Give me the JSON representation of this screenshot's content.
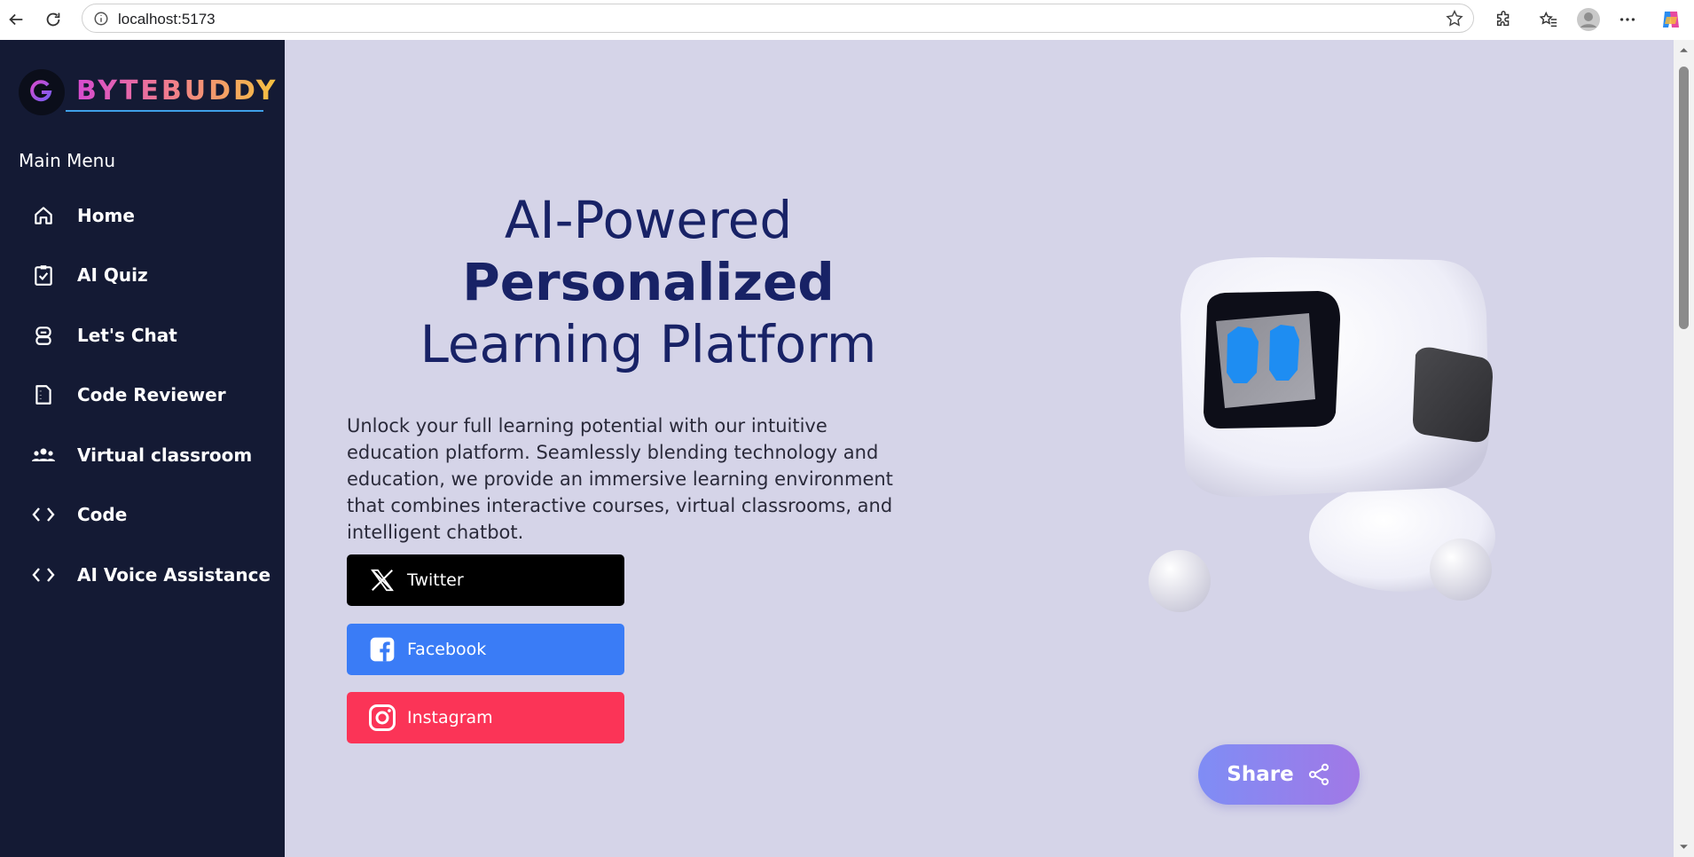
{
  "browser": {
    "url": "localhost:5173"
  },
  "sidebar": {
    "brand": "BYTEBUDDY",
    "menu_title": "Main Menu",
    "items": [
      {
        "label": "Home",
        "icon": "home-icon"
      },
      {
        "label": "AI Quiz",
        "icon": "clipboard-check-icon"
      },
      {
        "label": "Let's Chat",
        "icon": "robot-icon"
      },
      {
        "label": "Code Reviewer",
        "icon": "document-icon"
      },
      {
        "label": "Virtual classroom",
        "icon": "users-icon"
      },
      {
        "label": "Code",
        "icon": "code-icon"
      },
      {
        "label": "AI Voice Assistance",
        "icon": "code-icon"
      }
    ]
  },
  "hero": {
    "line1": "AI-Powered",
    "line2": "Personalized",
    "line3": "Learning Platform",
    "description": "Unlock your full learning potential with our intuitive education platform. Seamlessly blending technology and education, we provide an immersive learning environment that combines interactive courses, virtual classrooms, and intelligent chatbot."
  },
  "social": {
    "twitter": "Twitter",
    "facebook": "Facebook",
    "instagram": "Instagram"
  },
  "share": {
    "label": "Share"
  },
  "colors": {
    "sidebar_bg": "#141a34",
    "main_bg": "#d5d4e8",
    "title_color": "#182266",
    "twitter": "#000000",
    "facebook": "#3a7cf6",
    "instagram": "#fb3457"
  }
}
